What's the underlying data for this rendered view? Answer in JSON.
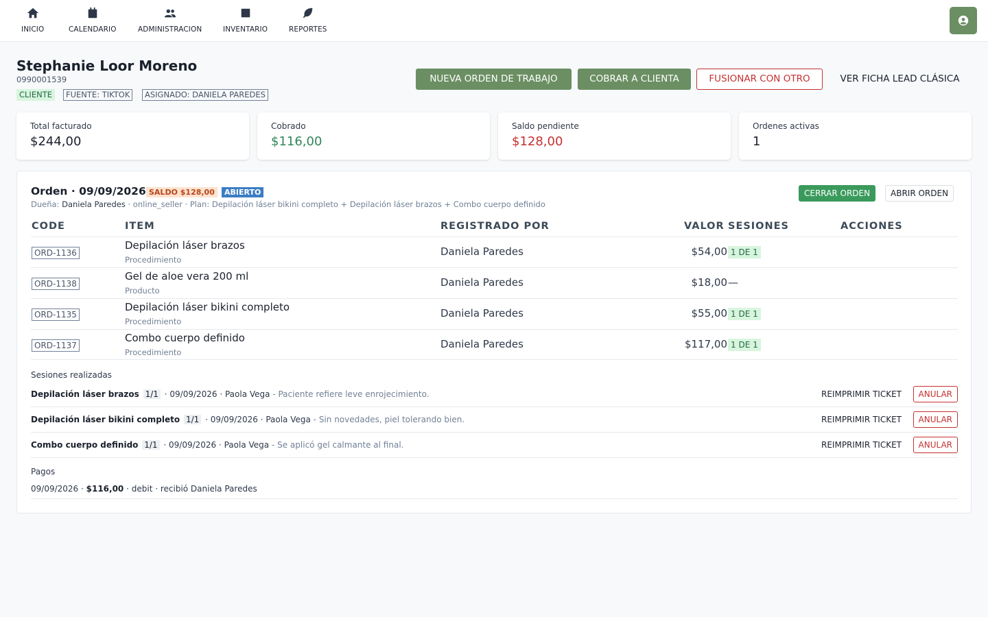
{
  "nav": {
    "items": [
      {
        "label": "INICIO",
        "icon": "home-icon"
      },
      {
        "label": "CALENDARIO",
        "icon": "calendar-icon"
      },
      {
        "label": "ADMINISTRACION",
        "icon": "users-icon"
      },
      {
        "label": "INVENTARIO",
        "icon": "box-icon"
      },
      {
        "label": "REPORTES",
        "icon": "leaf-icon"
      }
    ],
    "user_icon": "user-circle-icon"
  },
  "client": {
    "name": "Stephanie Loor Moreno",
    "id": "0990001539",
    "tags": [
      "CLIENTE",
      "FUENTE: TIKTOK",
      "ASIGNADO: DANIELA PAREDES"
    ]
  },
  "actions": {
    "new_order": "NUEVA ORDEN DE TRABAJO",
    "charge": "COBRAR A CLIENTA",
    "merge": "FUSIONAR CON OTRO",
    "classic": "VER FICHA LEAD CLÁSICA"
  },
  "stats": [
    {
      "label": "Total facturado",
      "value": "$244,00",
      "color": "#1a202c"
    },
    {
      "label": "Cobrado",
      "value": "$116,00",
      "color": "#2f855a"
    },
    {
      "label": "Saldo pendiente",
      "value": "$128,00",
      "color": "#c53030"
    },
    {
      "label": "Ordenes activas",
      "value": "1",
      "color": "#1a202c"
    }
  ],
  "order": {
    "title": "Orden · 09/09/2026",
    "saldo_badge": "SALDO $128,00",
    "status_badge": "ABIERTO",
    "owner_label": "Dueña:",
    "owner": "Daniela Paredes",
    "details": "· online_seller · Plan: Depilación láser bikini completo + Depilación láser brazos + Combo cuerpo definido",
    "close_btn": "CERRAR ORDEN",
    "open_btn": "ABRIR ORDEN",
    "columns": [
      "CODE",
      "ITEM",
      "REGISTRADO POR",
      "VALOR",
      "SESIONES",
      "ACCIONES"
    ],
    "rows": [
      {
        "code": "ORD-1136",
        "item": "Depilación láser brazos",
        "type": "Procedimiento",
        "registered_by": "Daniela Paredes",
        "valor": "$54,00",
        "sesiones": "1 DE 1"
      },
      {
        "code": "ORD-1138",
        "item": "Gel de aloe vera 200 ml",
        "type": "Producto",
        "registered_by": "Daniela Paredes",
        "valor": "$18,00",
        "sesiones": "—"
      },
      {
        "code": "ORD-1135",
        "item": "Depilación láser bikini completo",
        "type": "Procedimiento",
        "registered_by": "Daniela Paredes",
        "valor": "$55,00",
        "sesiones": "1 DE 1"
      },
      {
        "code": "ORD-1137",
        "item": "Combo cuerpo definido",
        "type": "Procedimiento",
        "registered_by": "Daniela Paredes",
        "valor": "$117,00",
        "sesiones": "1 DE 1"
      }
    ],
    "sessions_label": "Sesiones realizadas",
    "sessions": [
      {
        "name": "Depilación láser brazos",
        "frac": "1/1",
        "info": "· 09/09/2026 · Paola Vega",
        "note": "- Paciente refiere leve enrojecimiento."
      },
      {
        "name": "Depilación láser bikini completo",
        "frac": "1/1",
        "info": "· 09/09/2026 · Paola Vega",
        "note": "- Sin novedades, piel tolerando bien."
      },
      {
        "name": "Combo cuerpo definido",
        "frac": "1/1",
        "info": "· 09/09/2026 · Paola Vega",
        "note": "- Se aplicó gel calmante al final."
      }
    ],
    "reprint_label": "REIMPRIMIR TICKET",
    "void_label": "ANULAR",
    "payments_label": "Pagos",
    "payment": {
      "date": "09/09/2026 ·",
      "amount": "$116,00",
      "rest": "· debit · recibió Daniela Paredes"
    }
  }
}
